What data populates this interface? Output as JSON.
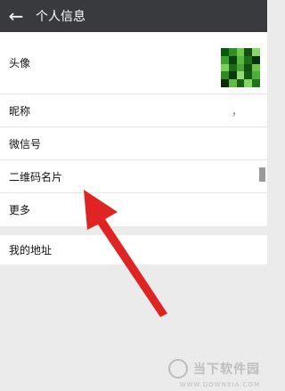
{
  "header": {
    "title": "个人信息",
    "back_icon": "arrow-left-icon"
  },
  "list": {
    "avatar_label": "头像",
    "nickname_label": "昵称",
    "nickname_value": "，",
    "wechat_label": "微信号",
    "qrcode_label": "二维码名片",
    "more_label": "更多"
  },
  "section2": {
    "address_label": "我的地址"
  },
  "watermark": {
    "brand": "当下软件园",
    "url": "WWW.DOWNXIA.COM"
  },
  "colors": {
    "header_bg": "#393a3e",
    "arrow": "#e02424",
    "page_bg": "#ebebeb"
  }
}
